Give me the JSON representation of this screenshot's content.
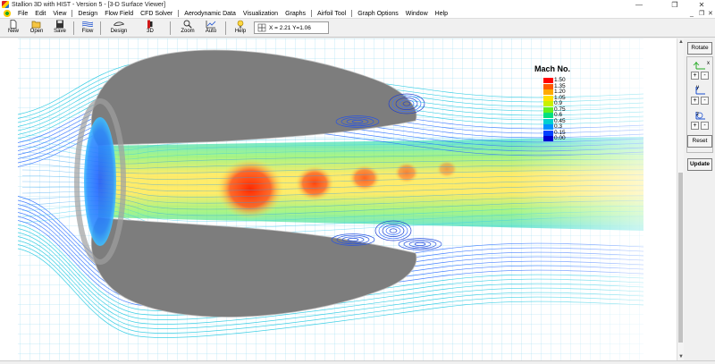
{
  "window": {
    "title": "Stallion 3D with HIST - Version 5 - [3-D Surface Viewer]",
    "minimize_glyph": "—",
    "maximize_glyph": "❐",
    "close_glyph": "✕"
  },
  "menu": {
    "items": [
      "File",
      "Edit",
      "View",
      "Design",
      "Flow Field",
      "CFD Solver",
      "Aerodynamic Data",
      "Visualization",
      "Graphs",
      "Airfoil Tool",
      "Graph Options",
      "Window",
      "Help"
    ],
    "mdi_minimize": "_",
    "mdi_restore": "❐",
    "mdi_close": "✕"
  },
  "toolbar": {
    "new": "New",
    "open": "Open",
    "save": "Save",
    "flow": "Flow",
    "design": "Design",
    "three_d": "3D",
    "zoom": "Zoom",
    "auto": "Auto",
    "help": "Help",
    "coords": "X = 2.21  Y=1.06"
  },
  "legend": {
    "title": "Mach No.",
    "values": [
      "1.50",
      "1.35",
      "1.20",
      "1.05",
      "0.9",
      "0.75",
      "0.6",
      "0.45",
      "0.3",
      "0.15",
      "0.00"
    ],
    "colors": [
      "#ff0000",
      "#ff5a00",
      "#ffaa00",
      "#ffe000",
      "#c8f000",
      "#60f020",
      "#00e080",
      "#00d0d0",
      "#0090ff",
      "#0040ff",
      "#0000d0"
    ]
  },
  "panel": {
    "rotate": "Rotate",
    "reset": "Reset",
    "update": "Update",
    "plus": "+",
    "minus": "-",
    "axis_x": "x",
    "axis_y": "y",
    "axis_z": "z"
  },
  "scroll": {
    "up": "▲",
    "down": "▼"
  }
}
